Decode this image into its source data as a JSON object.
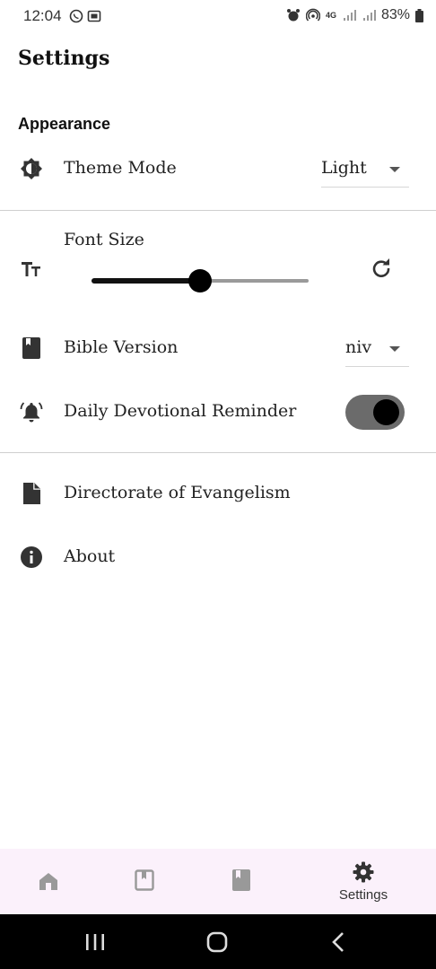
{
  "status_bar": {
    "time": "12:04",
    "battery": "83%",
    "network": "4G"
  },
  "header": {
    "title": "Settings"
  },
  "appearance": {
    "section_title": "Appearance",
    "theme_mode": {
      "label": "Theme Mode",
      "value": "Light",
      "icon": "brightness-icon"
    },
    "font_size": {
      "label": "Font Size",
      "icon": "text-size-icon",
      "slider_fraction": 0.5,
      "reset_icon": "refresh-icon"
    },
    "bible_version": {
      "label": "Bible Version",
      "value": "niv",
      "icon": "book-icon"
    },
    "daily_reminder": {
      "label": "Daily Devotional Reminder",
      "enabled": true,
      "icon": "bell-icon"
    }
  },
  "links": [
    {
      "label": "Directorate of Evangelism",
      "icon": "document-icon"
    },
    {
      "label": "About",
      "icon": "info-icon"
    }
  ],
  "bottom_nav": {
    "items": [
      {
        "icon": "home-icon",
        "label": ""
      },
      {
        "icon": "bookmark-book-icon",
        "label": ""
      },
      {
        "icon": "bible-icon",
        "label": ""
      },
      {
        "icon": "gear-icon",
        "label": "Settings"
      }
    ]
  },
  "colors": {
    "accent": "#000000",
    "nav_background": "#fbf1fb",
    "toggle_track": "#6b6b6b",
    "divider": "#cfcfcf"
  }
}
